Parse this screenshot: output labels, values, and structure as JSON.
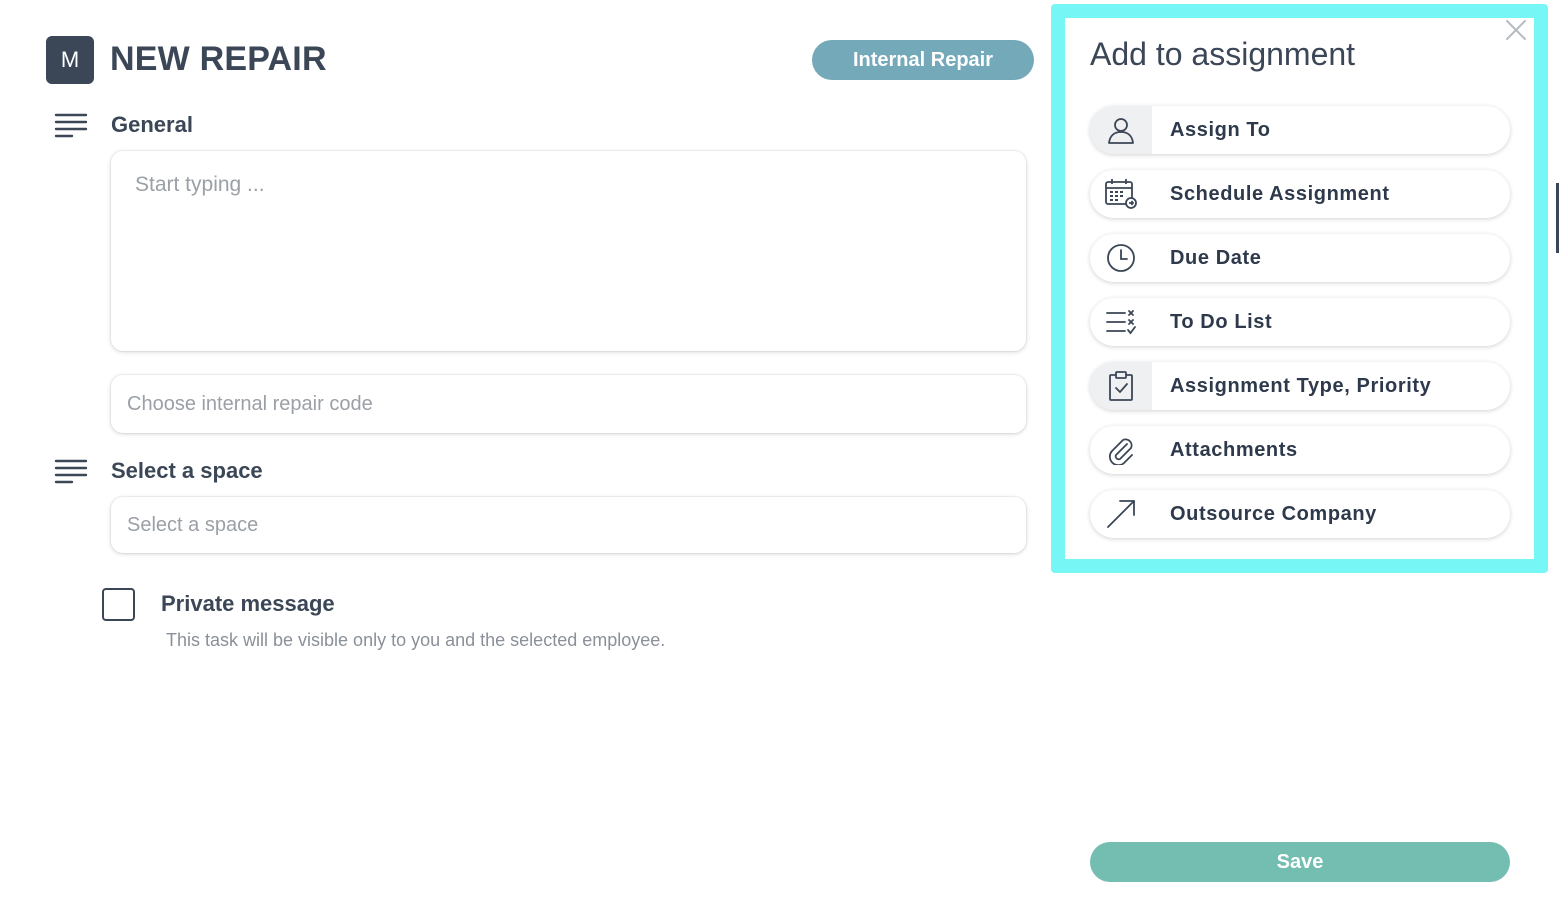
{
  "header": {
    "avatar_initial": "M",
    "title": "NEW REPAIR",
    "type_badge": "Internal Repair"
  },
  "general": {
    "label": "General",
    "description_placeholder": "Start typing ...",
    "repair_code_placeholder": "Choose internal repair code"
  },
  "space": {
    "label": "Select a space",
    "placeholder": "Select a space"
  },
  "private": {
    "checked": false,
    "label": "Private message",
    "hint": "This task will be visible only to you and the selected employee."
  },
  "panel": {
    "title": "Add to assignment",
    "items": [
      {
        "label": "Assign To",
        "icon": "person-icon"
      },
      {
        "label": "Schedule Assignment",
        "icon": "calendar-icon"
      },
      {
        "label": "Due Date",
        "icon": "clock-icon"
      },
      {
        "label": "To Do List",
        "icon": "checklist-icon"
      },
      {
        "label": "Assignment Type, Priority",
        "icon": "clipboard-check-icon"
      },
      {
        "label": "Attachments",
        "icon": "paperclip-icon"
      },
      {
        "label": "Outsource Company",
        "icon": "arrow-up-right-icon"
      }
    ]
  },
  "save_label": "Save",
  "colors": {
    "primary_dark": "#3b4656",
    "badge": "#73a9b8",
    "save": "#74bdb1",
    "highlight": "#77f6f6"
  }
}
